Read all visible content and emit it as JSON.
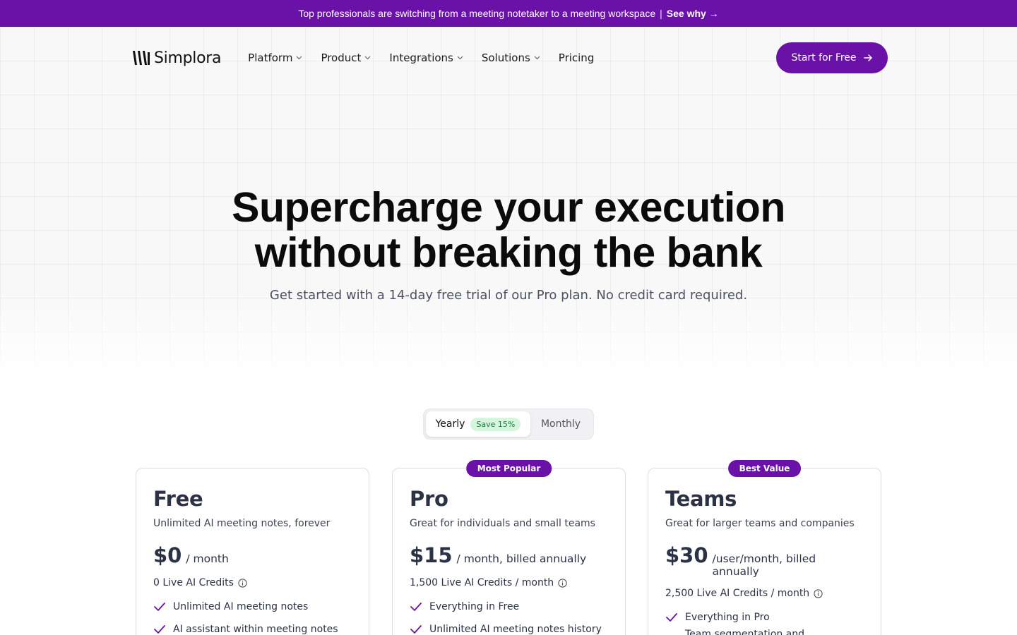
{
  "banner": {
    "message": "Top professionals are switching from a meeting notetaker to a meeting workspace",
    "separator": "|",
    "cta": "See why →"
  },
  "nav": {
    "brand": "Simplora",
    "items": [
      {
        "label": "Platform",
        "dropdown": true
      },
      {
        "label": "Product",
        "dropdown": true
      },
      {
        "label": "Integrations",
        "dropdown": true
      },
      {
        "label": "Solutions",
        "dropdown": true
      },
      {
        "label": "Pricing",
        "dropdown": false
      }
    ],
    "cta": "Start for Free"
  },
  "hero": {
    "headline_line1": "Supercharge your execution",
    "headline_line2": "without breaking the bank",
    "subline": "Get started with a 14-day free trial of our Pro plan. No credit card required."
  },
  "billing_toggle": {
    "yearly": "Yearly",
    "save_badge": "Save 15%",
    "monthly": "Monthly",
    "selected": "Yearly"
  },
  "plans": [
    {
      "badge": "",
      "name": "Free",
      "description": "Unlimited AI meeting notes, forever",
      "price": "$0",
      "period": "/ month",
      "credits": "0 Live AI Credits",
      "features": [
        "Unlimited AI meeting notes",
        "AI assistant within meeting notes"
      ]
    },
    {
      "badge": "Most Popular",
      "name": "Pro",
      "description": "Great for individuals and small teams",
      "price": "$15",
      "period": "/ month, billed annually",
      "credits": "1,500 Live AI Credits / month",
      "features": [
        "Everything in Free",
        "Unlimited AI meeting notes history"
      ]
    },
    {
      "badge": "Best Value",
      "name": "Teams",
      "description": "Great for larger teams and companies",
      "price": "$30",
      "period": "/user/month, billed annually",
      "credits": "2,500 Live AI Credits / month",
      "features": [
        "Everything in Pro",
        "Team segmentation and management"
      ]
    }
  ],
  "colors": {
    "brand": "#6a12a8",
    "save_badge_bg": "#d5f5dd",
    "save_badge_text": "#1b7a3c",
    "heading_text": "#2b3245"
  },
  "icons": {
    "logo": "logo-bars-icon",
    "dropdown": "chevron-down-icon",
    "cta": "arrow-right-icon",
    "credits_info": "info-icon",
    "feature": "check-icon"
  }
}
